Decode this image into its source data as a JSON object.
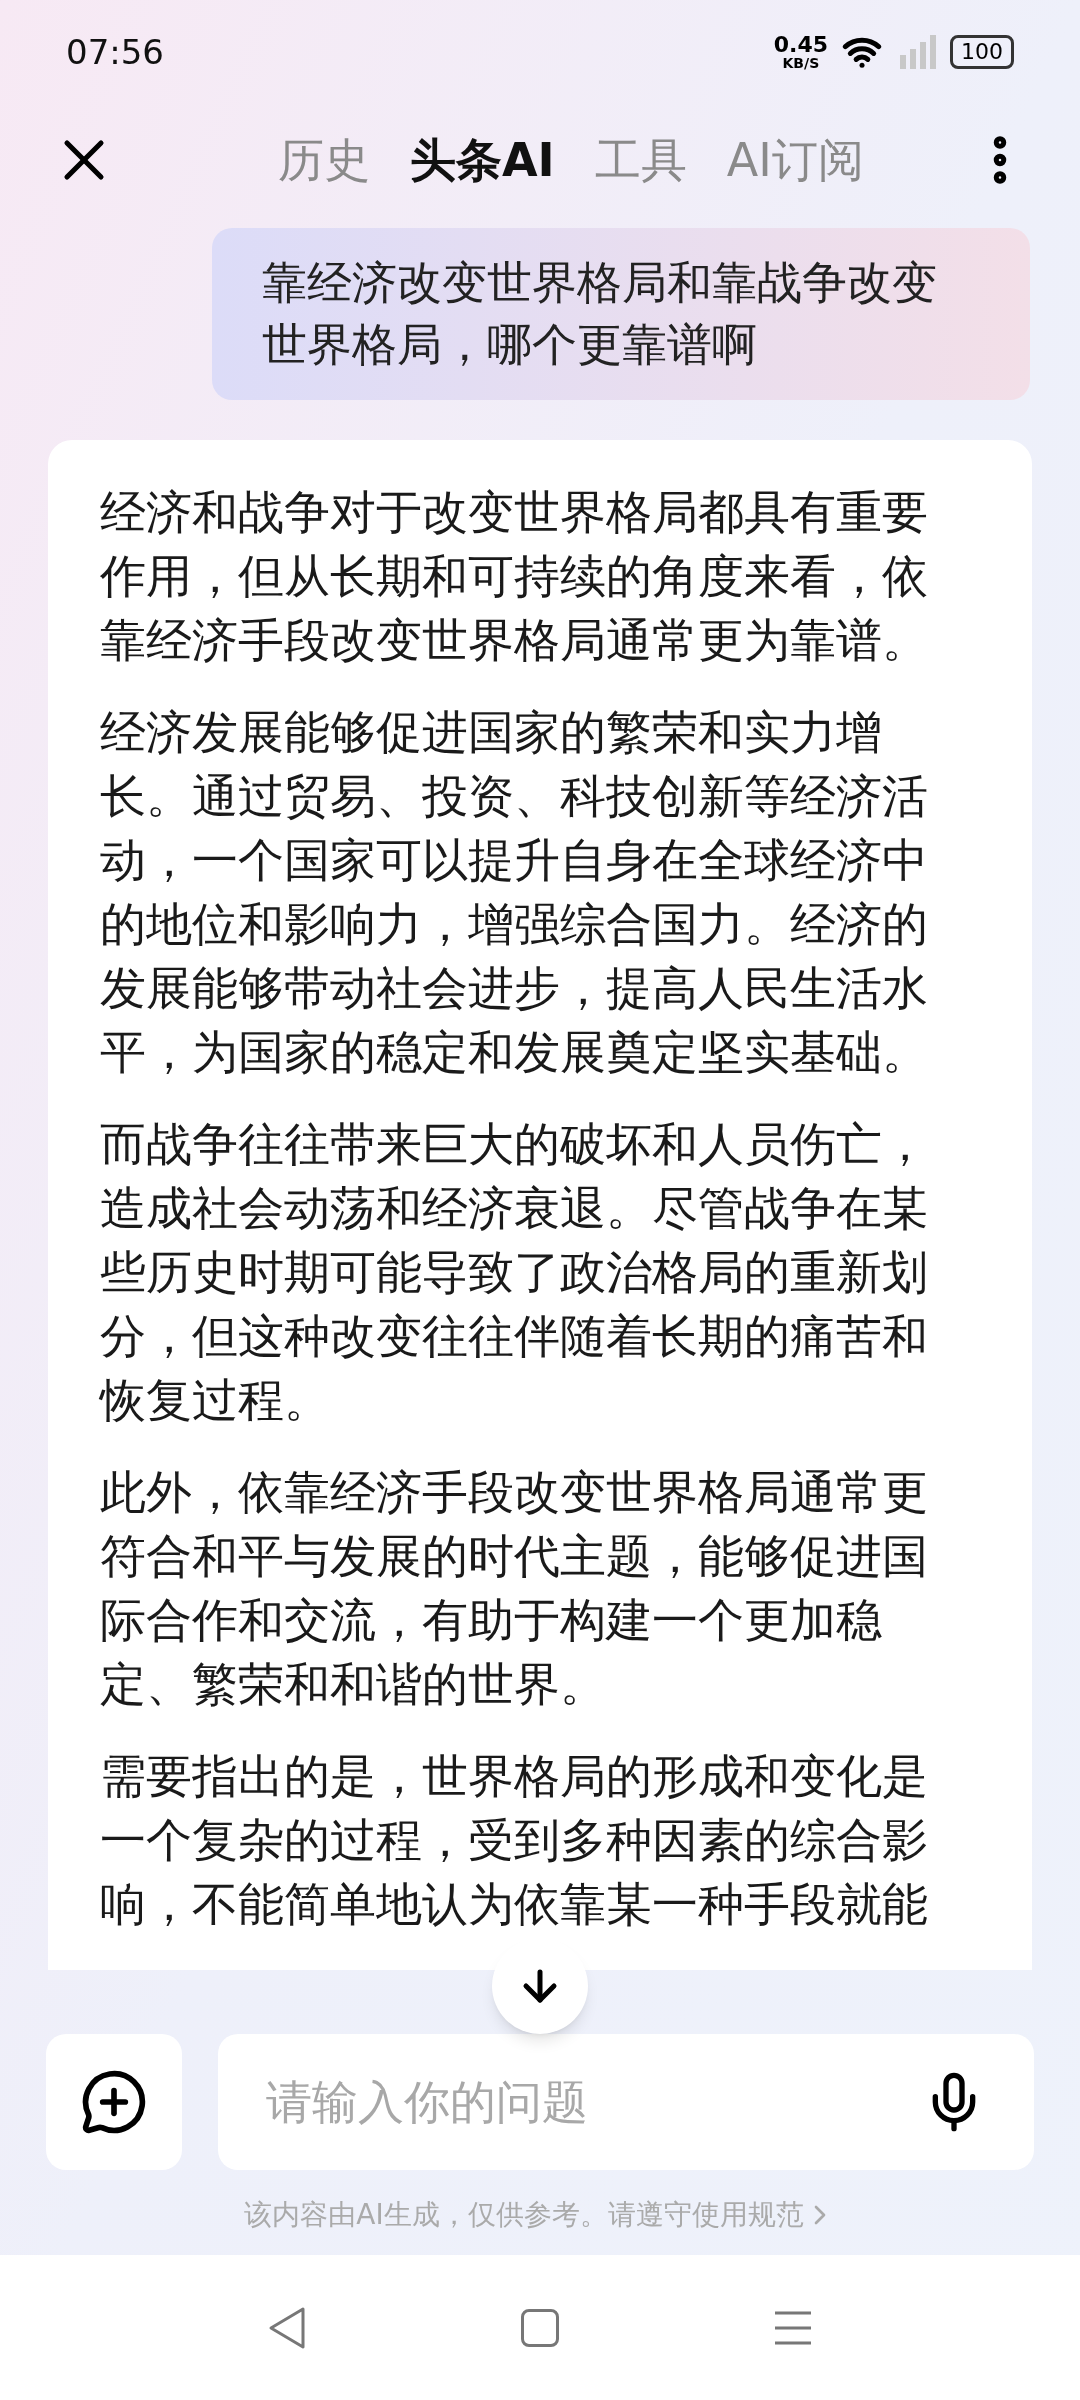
{
  "status_bar": {
    "time": "07:56",
    "speed": "0.45",
    "speed_unit": "KB/S",
    "battery": "100"
  },
  "tabs": [
    {
      "label": "历史",
      "selected": false
    },
    {
      "label": "头条AI",
      "selected": true
    },
    {
      "label": "工具",
      "selected": false
    },
    {
      "label": "AI订阅",
      "selected": false
    }
  ],
  "question": "靠经济改变世界格局和靠战争改变世界格局，哪个更靠谱啊",
  "answer": [
    "经济和战争对于改变世界格局都具有重要作用，但从长期和可持续的角度来看，依靠经济手段改变世界格局通常更为靠谱。",
    "经济发展能够促进国家的繁荣和实力增长。通过贸易、投资、科技创新等经济活动，一个国家可以提升自身在全球经济中的地位和影响力，增强综合国力。经济的发展能够带动社会进步，提高人民生活水平，为国家的稳定和发展奠定坚实基础。",
    "而战争往往带来巨大的破坏和人员伤亡，造成社会动荡和经济衰退。尽管战争在某些历史时期可能导致了政治格局的重新划分，但这种改变往往伴随着长期的痛苦和恢复过程。",
    "此外，依靠经济手段改变世界格局通常更符合和平与发展的时代主题，能够促进国际合作和交流，有助于构建一个更加稳定、繁荣和和谐的世界。",
    "需要指出的是，世界格局的形成和变化是一个复杂的过程，受到多种因素的综合影响，不能简单地认为依靠某一种手段就能"
  ],
  "input": {
    "placeholder": "请输入你的问题"
  },
  "disclaimer": "该内容由AI生成，仅供参考。请遵守使用规范"
}
